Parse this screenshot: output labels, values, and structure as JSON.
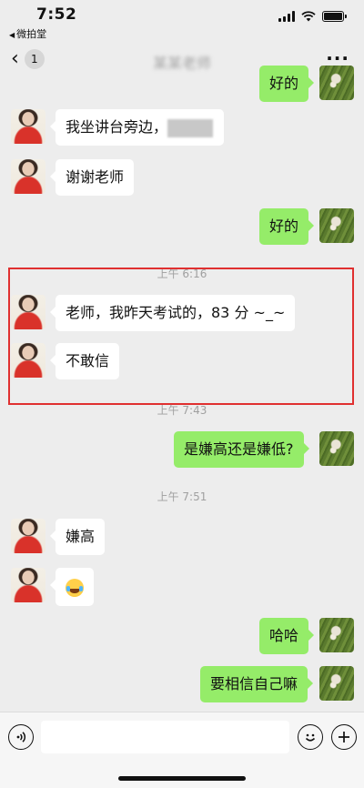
{
  "status_bar": {
    "time": "7:52",
    "back_app": "微拍堂"
  },
  "nav": {
    "unread_count": "1",
    "title": "某某老师",
    "more": "···"
  },
  "messages": [
    {
      "side": "right",
      "text": "好的"
    },
    {
      "side": "left",
      "text": "我坐讲台旁边，"
    },
    {
      "side": "left",
      "text": "谢谢老师"
    },
    {
      "side": "right",
      "text": "好的"
    },
    {
      "side": "time",
      "text": "上午 6:16"
    },
    {
      "side": "left",
      "text": "老师，我昨天考试的，83 分 ~_~"
    },
    {
      "side": "left",
      "text": "不敢信"
    },
    {
      "side": "time",
      "text": "上午 7:43"
    },
    {
      "side": "right",
      "text": "是嫌高还是嫌低?"
    },
    {
      "side": "time",
      "text": "上午 7:51"
    },
    {
      "side": "left",
      "text": "嫌高"
    },
    {
      "side": "left",
      "text": "",
      "emoji": "laughing-tears-emoji"
    },
    {
      "side": "right",
      "text": "哈哈"
    },
    {
      "side": "right",
      "text": "要相信自己嘛"
    }
  ],
  "highlight_color": "#e03030",
  "colors": {
    "background": "#ededed",
    "bubble_self": "#95ec69",
    "bubble_other": "#ffffff"
  }
}
